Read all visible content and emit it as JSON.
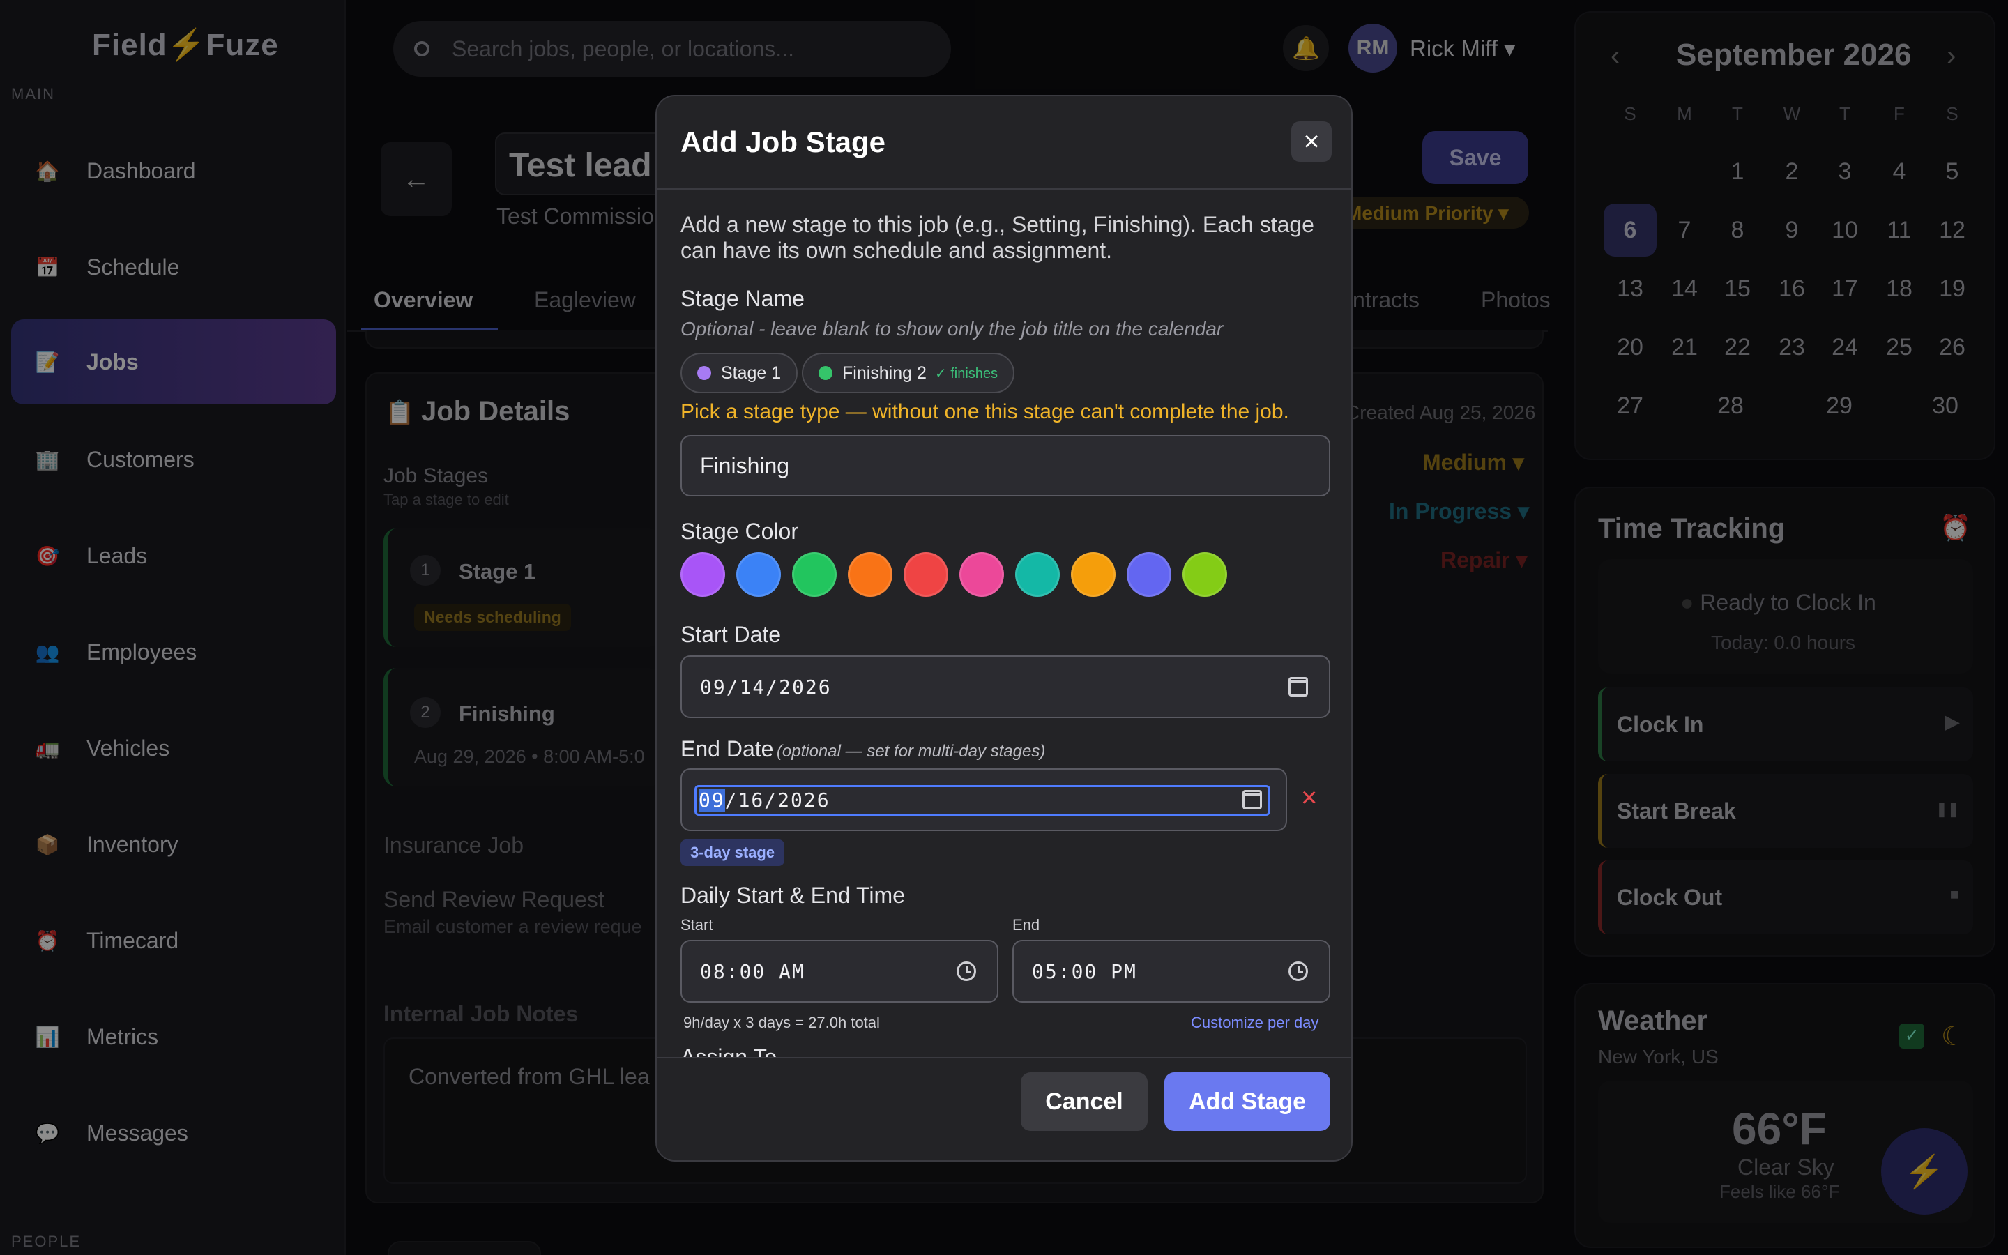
{
  "brand": {
    "name_left": "Field",
    "name_right": "Fuze"
  },
  "sidebar": {
    "section_main": "MAIN",
    "section_people": "PEOPLE",
    "items": [
      {
        "label": "Dashboard",
        "icon": "house-icon"
      },
      {
        "label": "Schedule",
        "icon": "calendar-icon"
      },
      {
        "label": "Jobs",
        "icon": "clipboard-icon"
      },
      {
        "label": "Customers",
        "icon": "building-icon"
      },
      {
        "label": "Leads",
        "icon": "target-icon"
      },
      {
        "label": "Employees",
        "icon": "people-icon"
      },
      {
        "label": "Vehicles",
        "icon": "truck-icon"
      },
      {
        "label": "Inventory",
        "icon": "box-icon"
      },
      {
        "label": "Timecard",
        "icon": "alarm-clock-icon"
      },
      {
        "label": "Metrics",
        "icon": "bar-chart-icon"
      },
      {
        "label": "Messages",
        "icon": "speech-bubble-icon"
      }
    ]
  },
  "topbar": {
    "search_placeholder": "Search jobs, people, or locations...",
    "avatar_initials": "RM",
    "user_name": "Rick Miff ▾"
  },
  "job": {
    "title": "Test lead",
    "subtitle": "Test Commissio",
    "save_label": "Save",
    "priority_label": "Medium Priority ▾",
    "tabs": [
      "Overview",
      "Eagleview",
      "ntracts",
      "Photos"
    ],
    "details_title": "Job Details",
    "created": "Created Aug 25, 2026",
    "stages_label": "Job Stages",
    "stages_hint": "Tap a stage to edit",
    "priority_value": "Medium ▾",
    "status_value": "In Progress ▾",
    "type_value": "Repair ▾",
    "stages": [
      {
        "num": "1",
        "name": "Stage 1",
        "badge": "Needs scheduling"
      },
      {
        "num": "2",
        "name": "Finishing",
        "when": "Aug 29, 2026 • 8:00 AM-5:0"
      }
    ],
    "insurance_label": "Insurance Job",
    "review_label": "Send Review Request",
    "review_hint": "Email customer a review reque",
    "notes_label": "Internal Job Notes",
    "notes_text": "Converted from GHL lea"
  },
  "calendar": {
    "title": "September 2026",
    "dow": [
      "S",
      "M",
      "T",
      "W",
      "T",
      "F",
      "S"
    ],
    "weeks": [
      [
        "",
        "",
        "1",
        "2",
        "3",
        "4",
        "5"
      ],
      [
        "6",
        "7",
        "8",
        "9",
        "10",
        "11",
        "12"
      ],
      [
        "13",
        "14",
        "15",
        "16",
        "17",
        "18",
        "19"
      ],
      [
        "20",
        "21",
        "22",
        "23",
        "24",
        "25",
        "26"
      ],
      [
        "27",
        "28",
        "29",
        "30"
      ]
    ],
    "today": "6"
  },
  "time_tracking": {
    "title": "Time Tracking",
    "status": "Ready to Clock In",
    "today": "Today: 0.0 hours",
    "actions": [
      {
        "label": "Clock In",
        "glyph": "▶",
        "color": "#2f7a46"
      },
      {
        "label": "Start Break",
        "glyph": "❚❚",
        "color": "#9c7a1c"
      },
      {
        "label": "Clock Out",
        "glyph": "■",
        "color": "#8a2a2a"
      }
    ]
  },
  "weather": {
    "title": "Weather",
    "location": "New York, US",
    "temp": "66°F",
    "condition": "Clear Sky",
    "feels": "Feels like 66°F"
  },
  "modal": {
    "title": "Add Job Stage",
    "description": "Add a new stage to this job (e.g., Setting, Finishing). Each stage can have its own schedule and assignment.",
    "stage_name_label": "Stage Name",
    "stage_name_help": "Optional - leave blank to show only the job title on the calendar",
    "chips": [
      {
        "label": "Stage 1",
        "color": "#a77bf3",
        "finishes": ""
      },
      {
        "label": "Finishing 2",
        "color": "#35c46a",
        "finishes": "✓ finishes"
      }
    ],
    "warning": "Pick a stage type — without one this stage can't complete the job.",
    "stage_name_value": "Finishing",
    "color_label": "Stage Color",
    "colors": [
      "#a855f7",
      "#3b82f6",
      "#22c55e",
      "#f97316",
      "#ef4444",
      "#ec4899",
      "#14b8a6",
      "#f59e0b",
      "#6366f1",
      "#84cc16"
    ],
    "start_date_label": "Start Date",
    "start_date_value": "09/14/2026",
    "end_date_label": "End Date",
    "end_date_help": "(optional — set for multi-day stages)",
    "end_date_value_month": "09",
    "end_date_value_rest": "/16/2026",
    "day_tag": "3-day stage",
    "time_label": "Daily Start & End Time",
    "start_label": "Start",
    "end_label": "End",
    "start_time": "08:00 AM",
    "end_time": "05:00 PM",
    "hours_summary": "9h/day x 3 days = 27.0h total",
    "customize_link": "Customize per day",
    "assign_label": "Assign To",
    "cancel_label": "Cancel",
    "add_label": "Add Stage"
  }
}
